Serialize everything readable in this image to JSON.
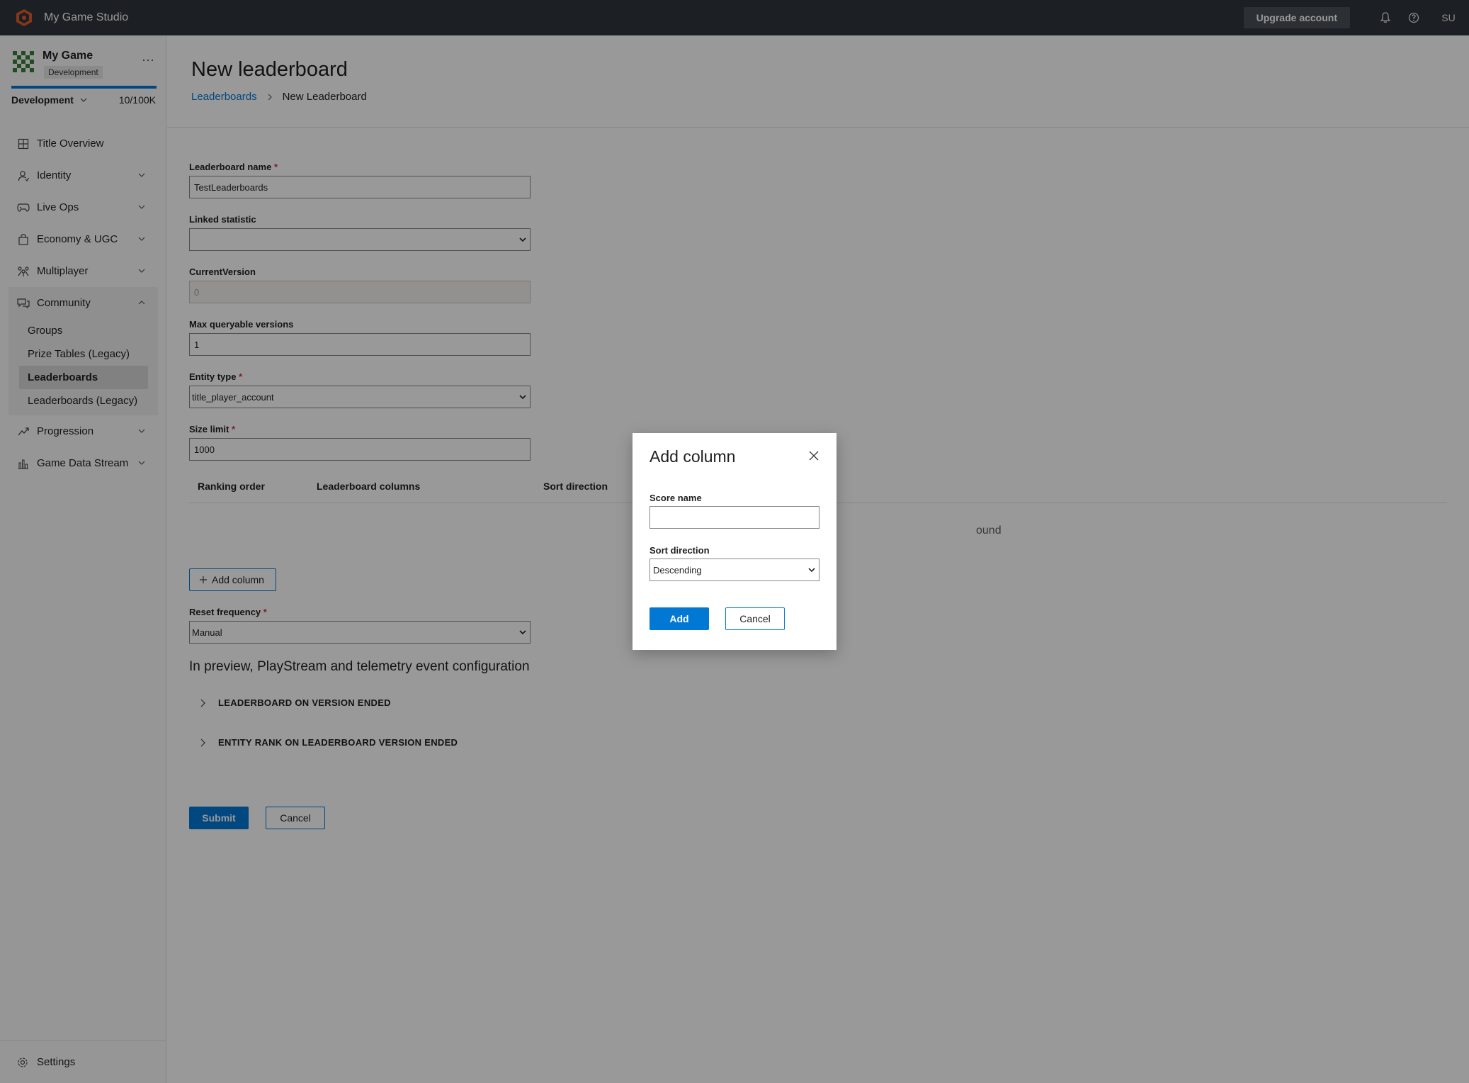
{
  "topbar": {
    "studio_name": "My Game Studio",
    "upgrade_label": "Upgrade account",
    "user_initials": "SU"
  },
  "sidebar": {
    "game_name": "My Game",
    "env_badge": "Development",
    "env_select": "Development",
    "usage": "10/100K",
    "usage_fraction": 1.0,
    "items": [
      {
        "label": "Title Overview",
        "icon": "grid-icon"
      },
      {
        "label": "Identity",
        "icon": "identity-icon"
      },
      {
        "label": "Live Ops",
        "icon": "gamepad-icon"
      },
      {
        "label": "Economy & UGC",
        "icon": "bag-icon"
      },
      {
        "label": "Multiplayer",
        "icon": "multiplayer-icon"
      },
      {
        "label": "Community",
        "icon": "chat-icon"
      },
      {
        "label": "Progression",
        "icon": "trend-icon"
      },
      {
        "label": "Game Data Stream",
        "icon": "chart-icon"
      }
    ],
    "community_sub": [
      "Groups",
      "Prize Tables (Legacy)",
      "Leaderboards",
      "Leaderboards (Legacy)"
    ],
    "settings_label": "Settings"
  },
  "page": {
    "title": "New leaderboard",
    "breadcrumb": {
      "parent": "Leaderboards",
      "current": "New Leaderboard"
    }
  },
  "form": {
    "name_label": "Leaderboard name",
    "name_value": "TestLeaderboards",
    "linked_label": "Linked statistic",
    "linked_value": "",
    "version_label": "CurrentVersion",
    "version_value": "0",
    "max_label": "Max queryable versions",
    "max_value": "1",
    "entity_label": "Entity type",
    "entity_value": "title_player_account",
    "size_label": "Size limit",
    "size_value": "1000",
    "columns": {
      "ranking": "Ranking order",
      "columns": "Leaderboard columns",
      "sort": "Sort direction"
    },
    "no_rows_partial": "ound",
    "add_column_label": "Add column",
    "reset_label": "Reset frequency",
    "reset_value": "Manual",
    "preview_title": "In preview, PlayStream and telemetry event configuration",
    "accordion_1": "LEADERBOARD ON VERSION ENDED",
    "accordion_2": "ENTITY RANK ON LEADERBOARD VERSION ENDED",
    "submit_label": "Submit",
    "cancel_label": "Cancel",
    "required_mark": "*"
  },
  "dialog": {
    "title": "Add column",
    "score_label": "Score name",
    "score_value": "",
    "sort_label": "Sort direction",
    "sort_value": "Descending",
    "add_label": "Add",
    "cancel_label": "Cancel"
  },
  "colors": {
    "accent": "#0078d4",
    "topbar": "#2f353b",
    "brand": "#e05a2b"
  }
}
